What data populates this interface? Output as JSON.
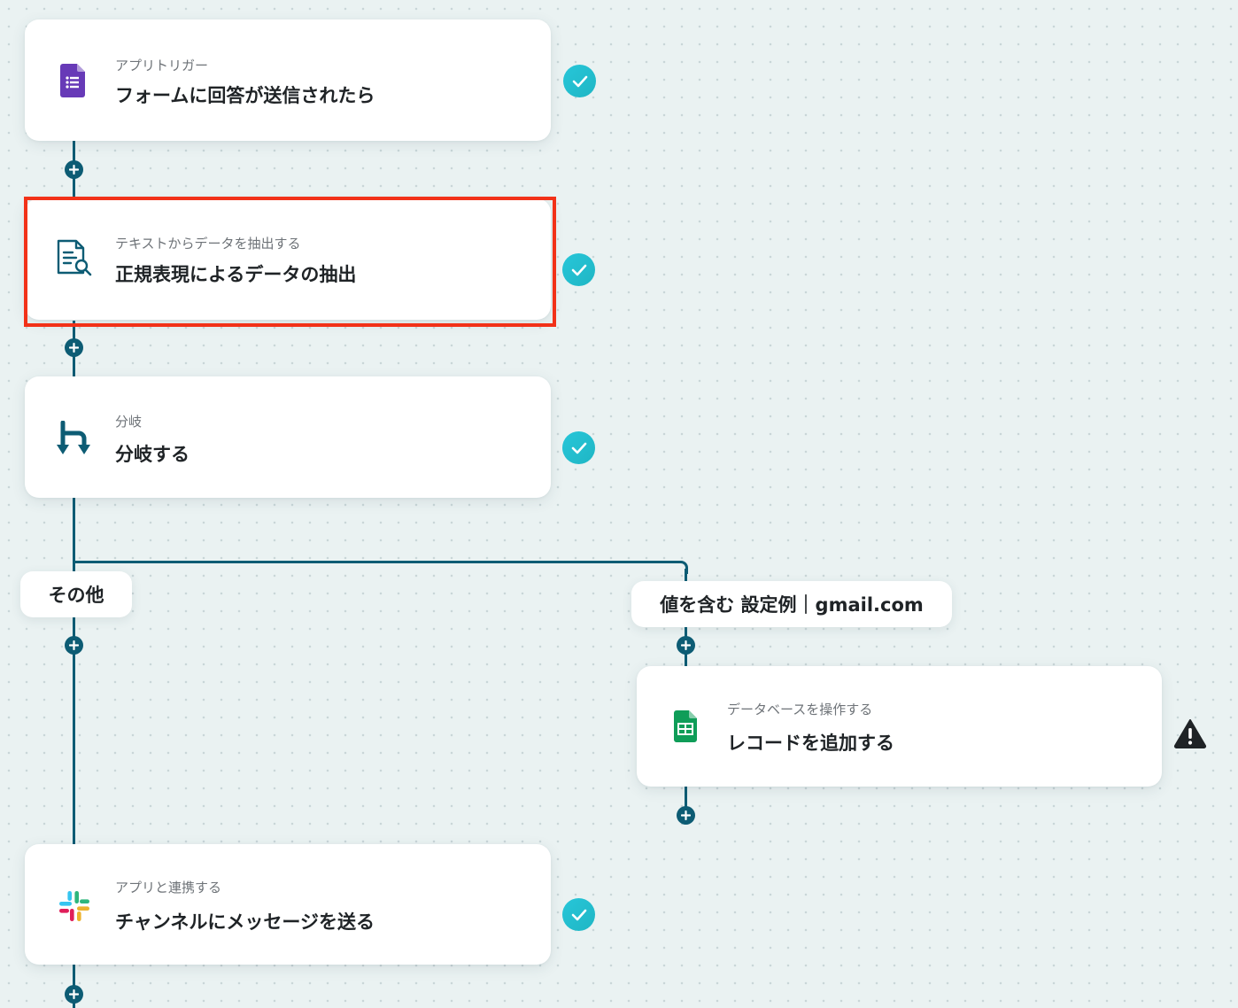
{
  "steps": [
    {
      "subtitle": "アプリトリガー",
      "title": "フォームに回答が送信されたら",
      "icon": "google-forms-icon",
      "status": "complete"
    },
    {
      "subtitle": "テキストからデータを抽出する",
      "title": "正規表現によるデータの抽出",
      "icon": "text-extract-icon",
      "status": "complete"
    },
    {
      "subtitle": "分岐",
      "title": "分岐する",
      "icon": "branch-icon",
      "status": "complete"
    },
    {
      "subtitle": "データベースを操作する",
      "title": "レコードを追加する",
      "icon": "google-sheets-icon",
      "status": "warning"
    },
    {
      "subtitle": "アプリと連携する",
      "title": "チャンネルにメッセージを送る",
      "icon": "slack-icon",
      "status": "complete"
    }
  ],
  "branches": {
    "other_label": "その他",
    "condition_label": "値を含む 設定例｜gmail.com"
  },
  "colors": {
    "connector": "#0d5c74",
    "check": "#27c6d9",
    "highlight": "#f23118",
    "forms_purple": "#673ab7",
    "sheets_green": "#0f9d58"
  }
}
